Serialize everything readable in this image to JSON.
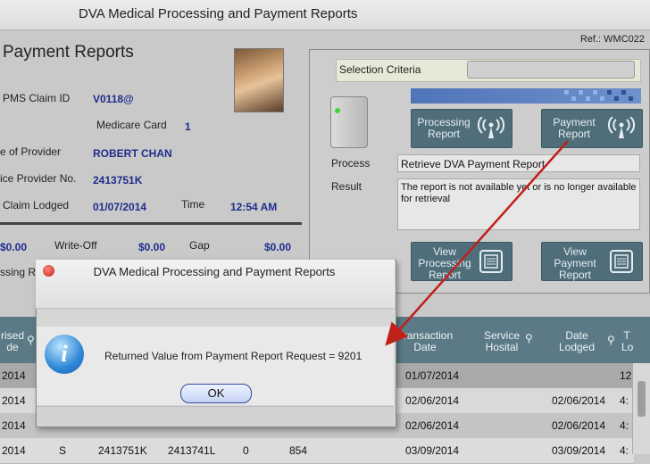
{
  "window": {
    "title": "DVA  Medical Processing and Payment Reports"
  },
  "ref": "Ref.: WMC022",
  "left": {
    "heading": "Payment Reports",
    "claim_id_label": "PMS Claim ID",
    "claim_id": "V0118@",
    "medicare_label": "Medicare Card",
    "medicare_value": "1",
    "provider_label": "e of Provider",
    "provider": "ROBERT CHAN",
    "provider_no_label": "ice Provider No.",
    "provider_no": "2413751K",
    "lodged_label": "Claim Lodged",
    "lodged": "01/07/2014",
    "time_label": "Time",
    "time": "12:54 AM",
    "amount1": "$0.00",
    "writeoff_label": "Write-Off",
    "writeoff": "$0.00",
    "gap_label": "Gap",
    "gap": "$0.00",
    "processing_cut": "ssing R"
  },
  "right": {
    "selection_label": "Selection Criteria",
    "processing_btn": "Processing Report",
    "payment_btn": "Payment Report",
    "process_label": "Process",
    "process_value": "Retrieve DVA Payment Report",
    "result_label": "Result",
    "result_value": "The report is not available yet or is no longer available for retrieval",
    "view_processing_btn": "View Processing Report",
    "view_payment_btn": "View Payment Report"
  },
  "grid": {
    "headers": {
      "col1": "rised de",
      "trans": "Transaction Date",
      "service": "Service Hosital",
      "lodged": "Date Lodged",
      "last": "T Lo"
    },
    "rows": [
      {
        "c1": "2014",
        "trans": "01/07/2014",
        "lodged": "",
        "last": "12"
      },
      {
        "c1": "2014",
        "trans": "02/06/2014",
        "lodged": "02/06/2014",
        "last": "4:"
      },
      {
        "c1": "2014",
        "trans": "02/06/2014",
        "lodged": "02/06/2014",
        "last": "4:"
      },
      {
        "c1": "2014",
        "s": "S",
        "p1": "2413751K",
        "p2": "2413741L",
        "z": "0",
        "n": "854",
        "trans": "03/09/2014",
        "lodged": "03/09/2014",
        "last": "4:"
      }
    ]
  },
  "dialog": {
    "title": "DVA  Medical Processing and Payment Reports",
    "message": "Returned Value from Payment Report Request = 9201",
    "ok": "OK"
  },
  "colors": {
    "grid_header": "#5b7a86",
    "button": "#4f6e7a",
    "arrow": "#c0201a"
  }
}
